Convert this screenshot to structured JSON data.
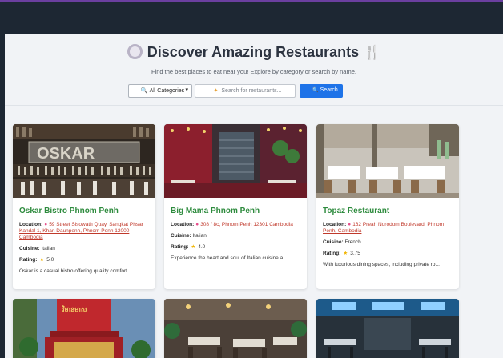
{
  "header": {
    "title": "Discover Amazing Restaurants",
    "subtitle": "Find the best places to eat near you! Explore by category or search by name."
  },
  "search": {
    "category_selected": "All Categories",
    "placeholder": "Search for restaurants...",
    "button_label": "Search"
  },
  "labels": {
    "location": "Location:",
    "cuisine": "Cuisine:",
    "rating": "Rating:"
  },
  "restaurants": [
    {
      "name": "Oskar Bistro Phnom Penh",
      "location": "59 Street Sisowath Quay, Sangkat Phsar Kandal 1, Khan Daunpenh, Phnom Penh 12000 Cambodia",
      "cuisine": "Italian",
      "rating": "5.0",
      "description": "Oskar is a casual bistro offering quality comfort ..."
    },
    {
      "name": "Big Mama Phnom Penh",
      "location": "308 / 8c, Phnom Penh 12301 Cambodia",
      "cuisine": "Italian",
      "rating": "4.0",
      "description": "Experience the heart and soul of Italian cuisine a..."
    },
    {
      "name": "Topaz Restaurant",
      "location": "162 Preah Norodom Boulevard, Phnom Penh, Cambodia",
      "cuisine": "French",
      "rating": "3.75",
      "description": "With luxurious dining spaces, including private ro..."
    }
  ],
  "colors": {
    "accent": "#1e73e8",
    "name": "#2e8b3e",
    "location_link": "#c0392b",
    "star": "#f0b400"
  },
  "icons": [
    "plate-icon",
    "cutlery-icon",
    "search-icon",
    "lightbulb-icon",
    "pin-icon",
    "star-icon"
  ]
}
